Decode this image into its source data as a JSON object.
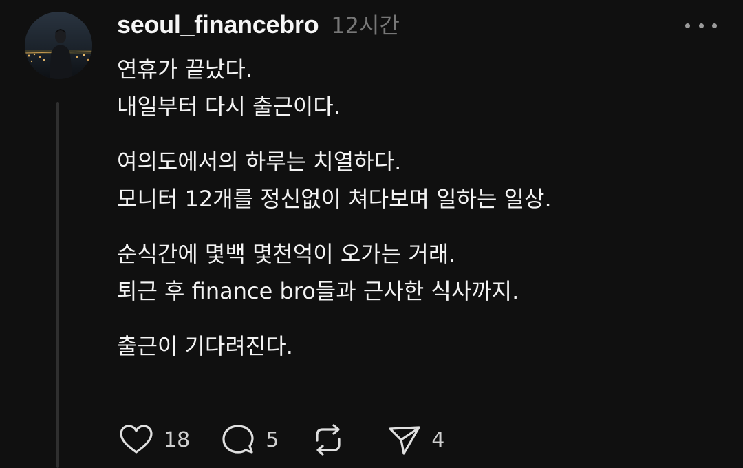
{
  "post": {
    "username": "seoul_financebro",
    "time": "12시간",
    "paragraphs": [
      [
        "연휴가 끝났다.",
        "내일부터 다시 출근이다."
      ],
      [
        "여의도에서의 하루는 치열하다.",
        "모니터 12개를 정신없이 쳐다보며 일하는 일상."
      ],
      [
        "순식간에 몇백 몇천억이 오가는 거래.",
        "퇴근 후 finance bro들과 근사한 식사까지."
      ],
      [
        "출근이 기다려진다."
      ]
    ]
  },
  "actions": {
    "like": {
      "icon": "heart-icon",
      "count": "18"
    },
    "reply": {
      "icon": "comment-icon",
      "count": "5"
    },
    "repost": {
      "icon": "repost-icon",
      "count": ""
    },
    "share": {
      "icon": "send-icon",
      "count": "4"
    }
  },
  "colors": {
    "background": "#101010",
    "text": "#f3f3f3",
    "muted": "#777777",
    "icon": "#e0e0e0"
  }
}
